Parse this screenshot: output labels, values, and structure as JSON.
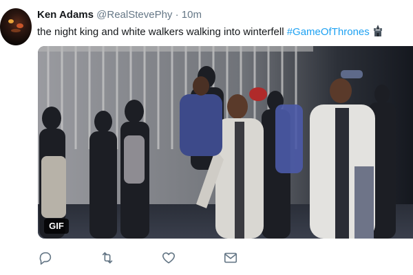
{
  "tweet": {
    "author_name": "Ken Adams",
    "handle": "@RealStevePhy",
    "separator": "·",
    "timestamp": "10m",
    "text_main": "the night king and white walkers walking into winterfell ",
    "hashtag": "#GameOfThrones",
    "emoji": "castle-emoji-icon",
    "media_badge": "GIF"
  },
  "actions": {
    "reply": "reply-icon",
    "retweet": "retweet-icon",
    "like": "heart-icon",
    "message": "direct-message-icon"
  },
  "colors": {
    "link": "#1da1f2",
    "secondary_text": "#657786",
    "primary_text": "#14171a",
    "icon": "#657786"
  }
}
